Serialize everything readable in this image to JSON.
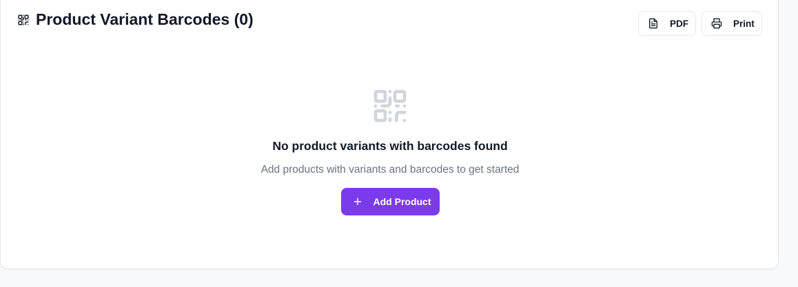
{
  "header": {
    "title": "Product Variant Barcodes (0)",
    "icon": "qr-code-icon"
  },
  "actions": {
    "pdf_label": "PDF",
    "pdf_icon": "file-text-icon",
    "print_label": "Print",
    "print_icon": "printer-icon"
  },
  "empty_state": {
    "icon": "qr-code-icon",
    "title": "No product variants with barcodes found",
    "subtitle": "Add products with variants and barcodes to get started",
    "button_label": "Add Product",
    "button_icon": "plus-icon"
  },
  "colors": {
    "accent": "#7c3aed",
    "empty_icon": "#d1d5db",
    "muted_text": "#6b7280",
    "page_background": "#f8f9fb"
  }
}
